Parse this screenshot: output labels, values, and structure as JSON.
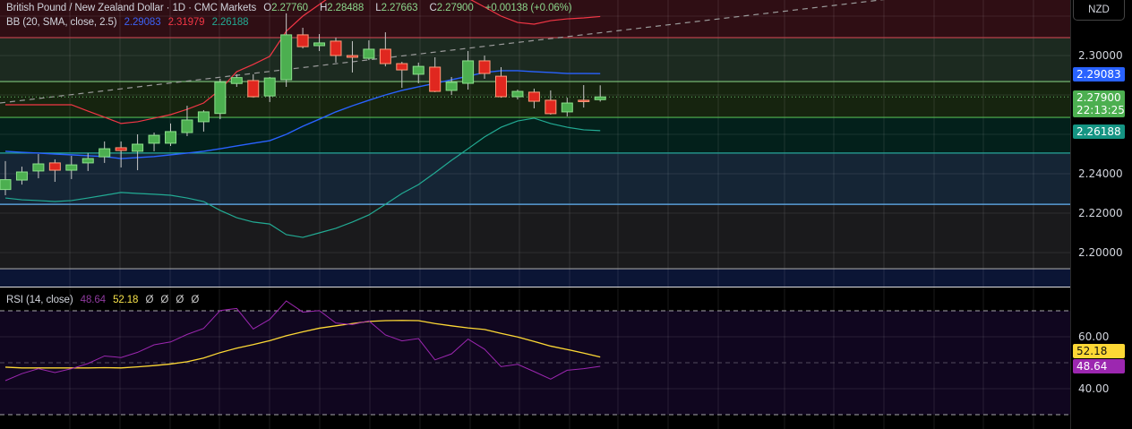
{
  "header": {
    "symbol": "British Pound / New Zealand Dollar · 1D · CMC Markets",
    "o_label": "O",
    "o_value": "2.27760",
    "h_label": "H",
    "h_value": "2.28488",
    "l_label": "L",
    "l_value": "2.27663",
    "c_label": "C",
    "c_value": "2.27900",
    "change": "+0.00138 (+0.06%)"
  },
  "bb_legend": {
    "label": "BB (20, SMA, close, 2.5)",
    "basis": "2.29083",
    "upper": "2.31979",
    "lower": "2.26188"
  },
  "rsi_legend": {
    "label": "RSI (14, close)",
    "rsi": "48.64",
    "ma": "52.18",
    "extras": [
      "Ø",
      "Ø",
      "Ø",
      "Ø"
    ]
  },
  "currency_button": "NZD",
  "price_axis": {
    "labels": [
      "2.30000",
      "2.24000",
      "2.22000",
      "2.20000"
    ],
    "tag_basis": "2.29083",
    "tag_last": "2.27900",
    "tag_countdown": "22:13:25",
    "tag_lower": "2.26188"
  },
  "rsi_axis": {
    "labels": [
      "60.00",
      "40.00"
    ],
    "tag_ma": "52.18",
    "tag_rsi": "48.64"
  },
  "colors": {
    "up": "#4caf50",
    "down": "#e0271f",
    "basis": "#2962ff",
    "upper": "#f23645",
    "lower": "#22ab94",
    "rsi": "#9c27b0",
    "rsi_ma": "#fdd835"
  },
  "chart_data": [
    {
      "type": "candlestick",
      "title": "British Pound / New Zealand Dollar · 1D · CMC Markets",
      "ylim": [
        2.1875,
        2.3282
      ],
      "yticks": [
        2.2,
        2.22,
        2.24,
        2.3
      ],
      "candles_ohlc": [
        [
          2.232,
          2.2464,
          2.2291,
          2.237
        ],
        [
          2.2368,
          2.2436,
          2.2345,
          2.2409
        ],
        [
          2.2414,
          2.25,
          2.2377,
          2.245
        ],
        [
          2.2455,
          2.2473,
          2.2359,
          2.2418
        ],
        [
          2.2418,
          2.2491,
          2.2373,
          2.2445
        ],
        [
          2.2455,
          2.2505,
          2.2414,
          2.2477
        ],
        [
          2.2486,
          2.2564,
          2.2455,
          2.2527
        ],
        [
          2.2532,
          2.2564,
          2.2432,
          2.2518
        ],
        [
          2.2514,
          2.26,
          2.2418,
          2.255
        ],
        [
          2.2555,
          2.2609,
          2.2514,
          2.2595
        ],
        [
          2.2555,
          2.2655,
          2.2541,
          2.2614
        ],
        [
          2.2609,
          2.2745,
          2.2591,
          2.2673
        ],
        [
          2.2664,
          2.2723,
          2.2614,
          2.2714
        ],
        [
          2.2706,
          2.2882,
          2.2677,
          2.2865
        ],
        [
          2.2858,
          2.2905,
          2.2841,
          2.2888
        ],
        [
          2.2873,
          2.2905,
          2.2786,
          2.2791
        ],
        [
          2.2795,
          2.2891,
          2.2764,
          2.2886
        ],
        [
          2.2877,
          2.3214,
          2.2841,
          2.3105
        ],
        [
          2.3105,
          2.3141,
          2.3036,
          2.3045
        ],
        [
          2.305,
          2.3109,
          2.3023,
          2.3064
        ],
        [
          2.3073,
          2.3091,
          2.2964,
          2.3
        ],
        [
          2.3,
          2.3073,
          2.2914,
          2.2991
        ],
        [
          2.2986,
          2.3077,
          2.2977,
          2.3032
        ],
        [
          2.3032,
          2.3118,
          2.2945,
          2.2959
        ],
        [
          2.2959,
          2.2968,
          2.2836,
          2.2927
        ],
        [
          2.2905,
          2.2964,
          2.2859,
          2.2945
        ],
        [
          2.2941,
          2.2991,
          2.2814,
          2.2818
        ],
        [
          2.2823,
          2.2891,
          2.28,
          2.2864
        ],
        [
          2.2859,
          2.3023,
          2.2827,
          2.2973
        ],
        [
          2.2973,
          2.3,
          2.2882,
          2.2909
        ],
        [
          2.2895,
          2.2941,
          2.2786,
          2.2791
        ],
        [
          2.2791,
          2.2827,
          2.2777,
          2.2818
        ],
        [
          2.2814,
          2.2832,
          2.2732,
          2.2768
        ],
        [
          2.2773,
          2.2823,
          2.27,
          2.2705
        ],
        [
          2.2714,
          2.2786,
          2.2691,
          2.2759
        ],
        [
          2.2773,
          2.285,
          2.2736,
          2.2772
        ],
        [
          2.2776,
          2.28488,
          2.27663,
          2.279
        ]
      ],
      "bb_upper": [
        2.275,
        2.275,
        2.275,
        2.275,
        2.275,
        2.2718,
        2.2687,
        2.2655,
        2.2664,
        2.2682,
        2.27,
        2.2727,
        2.2759,
        2.2827,
        2.2918,
        2.2955,
        2.2996,
        2.3123,
        2.32,
        2.3259,
        2.3318,
        2.3364,
        2.3391,
        2.34,
        2.34,
        2.3391,
        2.3373,
        2.3336,
        2.3291,
        2.3246,
        2.32,
        2.3168,
        2.3159,
        2.3177,
        2.3186,
        2.3191,
        2.31979
      ],
      "bb_basis": [
        2.2514,
        2.2509,
        2.2505,
        2.25,
        2.2496,
        2.2491,
        2.2487,
        2.2477,
        2.2482,
        2.2487,
        2.2496,
        2.2505,
        2.2514,
        2.2527,
        2.2541,
        2.2555,
        2.2568,
        2.26,
        2.2641,
        2.2677,
        2.2714,
        2.2745,
        2.2773,
        2.28,
        2.2823,
        2.2841,
        2.2859,
        2.2877,
        2.2895,
        2.2914,
        2.2923,
        2.2923,
        2.2918,
        2.2914,
        2.2909,
        2.2909,
        2.29083
      ],
      "bb_lower": [
        2.2277,
        2.2268,
        2.2264,
        2.2259,
        2.2264,
        2.2277,
        2.2291,
        2.2305,
        2.23,
        2.2296,
        2.2291,
        2.2277,
        2.2259,
        2.2214,
        2.2177,
        2.2155,
        2.2145,
        2.2091,
        2.2077,
        2.21,
        2.2123,
        2.2155,
        2.2191,
        2.2245,
        2.23,
        2.2345,
        2.2405,
        2.2468,
        2.2527,
        2.2587,
        2.2636,
        2.2668,
        2.2682,
        2.2655,
        2.2636,
        2.2623,
        2.26188
      ],
      "zone_levels": [
        2.3091,
        2.2868,
        2.2686,
        2.2505,
        2.2245,
        2.1918
      ],
      "last_price": 2.279
    },
    {
      "type": "line",
      "title": "RSI (14, close)",
      "ylim": [
        25,
        78
      ],
      "yticks": [
        40,
        60
      ],
      "bands": [
        30,
        50,
        70
      ],
      "series": [
        {
          "name": "RSI",
          "values": [
            43.1,
            45.8,
            47.7,
            46.2,
            47.7,
            49.7,
            52.6,
            52.0,
            54.0,
            56.9,
            58.0,
            60.9,
            63.2,
            70.1,
            70.9,
            63.0,
            66.7,
            73.8,
            69.5,
            70.1,
            65.3,
            64.7,
            66.1,
            60.7,
            58.4,
            59.3,
            51.1,
            53.4,
            59.1,
            55.2,
            48.5,
            49.4,
            46.6,
            43.7,
            47.1,
            47.7,
            48.64
          ]
        },
        {
          "name": "RSI MA",
          "values": [
            48.3,
            48.0,
            48.0,
            48.0,
            48.0,
            48.0,
            48.1,
            48.0,
            48.4,
            48.9,
            49.5,
            50.4,
            51.8,
            53.9,
            55.6,
            57.0,
            58.5,
            60.4,
            61.9,
            63.3,
            64.2,
            65.1,
            65.9,
            66.2,
            66.3,
            66.2,
            65.1,
            64.2,
            63.4,
            62.8,
            61.3,
            59.9,
            58.2,
            56.4,
            55.1,
            53.7,
            52.18
          ]
        }
      ]
    }
  ]
}
